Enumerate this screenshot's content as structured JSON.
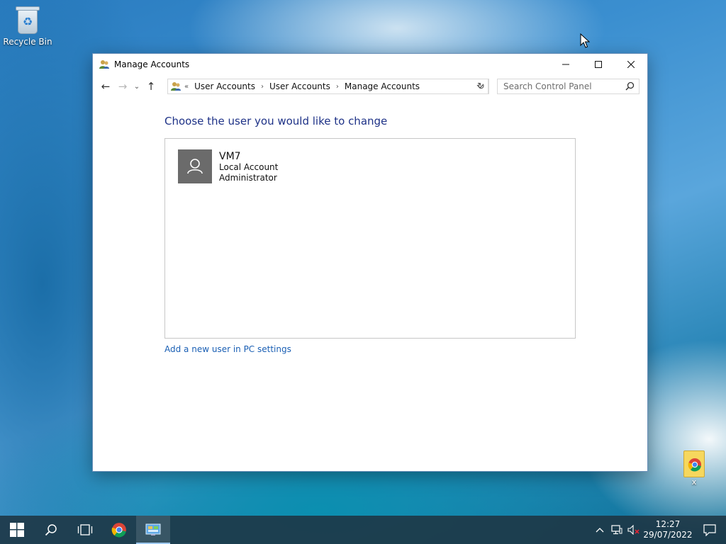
{
  "desktop": {
    "recycle_bin_label": "Recycle Bin",
    "chrome_shortcut_label": "x"
  },
  "window": {
    "title": "Manage Accounts",
    "controls": {
      "minimize": "—",
      "maximize": "☐",
      "close": "✕"
    }
  },
  "navigation": {
    "back_icon": "←",
    "forward_icon": "→",
    "recent_icon": "⌄",
    "up_icon": "↑",
    "overflow": "«",
    "breadcrumb": [
      "User Accounts",
      "User Accounts",
      "Manage Accounts"
    ],
    "separator": "›",
    "refresh_icon": "↻",
    "search_placeholder": "Search Control Panel"
  },
  "content": {
    "heading": "Choose the user you would like to change",
    "users": [
      {
        "name": "VM7",
        "account_type": "Local Account",
        "role": "Administrator"
      }
    ],
    "add_user_link": "Add a new user in PC settings"
  },
  "taskbar": {
    "clock_time": "12:27",
    "clock_date": "29/07/2022"
  },
  "colors": {
    "heading": "#1e3287",
    "link": "#1a5fb4",
    "avatar_bg": "#6b6b6b",
    "taskbar_bg": "#1e3442"
  }
}
